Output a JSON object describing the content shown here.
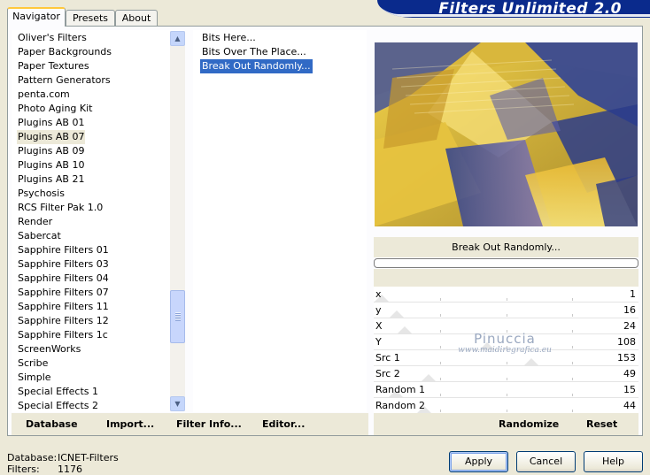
{
  "app": {
    "title": "Filters Unlimited 2.0"
  },
  "tabs": [
    {
      "label": "Navigator",
      "active": true
    },
    {
      "label": "Presets",
      "active": false
    },
    {
      "label": "About",
      "active": false
    }
  ],
  "categories": {
    "items": [
      "Oliver's Filters",
      "Paper Backgrounds",
      "Paper Textures",
      "Pattern Generators",
      "penta.com",
      "Photo Aging Kit",
      "Plugins AB 01",
      "Plugins AB 07",
      "Plugins AB 09",
      "Plugins AB 10",
      "Plugins AB 21",
      "Psychosis",
      "RCS Filter Pak 1.0",
      "Render",
      "Sabercat",
      "Sapphire Filters 01",
      "Sapphire Filters 03",
      "Sapphire Filters 04",
      "Sapphire Filters 07",
      "Sapphire Filters 11",
      "Sapphire Filters 12",
      "Sapphire Filters 1c",
      "ScreenWorks",
      "Scribe",
      "Simple",
      "Special Effects 1",
      "Special Effects 2"
    ],
    "selected": "Plugins AB 07"
  },
  "filters": {
    "items": [
      "Bits Here...",
      "Bits Over The Place...",
      "Break Out Randomly..."
    ],
    "selected": "Break Out Randomly..."
  },
  "preview": {
    "filter_name": "Break Out Randomly..."
  },
  "params": [
    {
      "label": "x",
      "value": "1"
    },
    {
      "label": "y",
      "value": "16"
    },
    {
      "label": "X",
      "value": "24"
    },
    {
      "label": "Y",
      "value": "108"
    },
    {
      "label": "Src 1",
      "value": "153"
    },
    {
      "label": "Src 2",
      "value": "49"
    },
    {
      "label": "Random 1",
      "value": "15"
    },
    {
      "label": "Random 2",
      "value": "44"
    }
  ],
  "param_levels": [
    1,
    16,
    24,
    108,
    153,
    49,
    15,
    44
  ],
  "param_max": 255,
  "watermark": {
    "name": "Pinuccia",
    "url": "www.maidiregrafica.eu"
  },
  "toolbar": {
    "database": "Database",
    "import": "Import...",
    "filter_info": "Filter Info...",
    "editor": "Editor...",
    "randomize": "Randomize",
    "reset": "Reset"
  },
  "footer": {
    "database_label": "Database:",
    "database_value": "ICNET-Filters",
    "filters_label": "Filters:",
    "filters_value": "1176",
    "apply": "Apply",
    "cancel": "Cancel",
    "help": "Help"
  },
  "colors": {
    "accent": "#316ac5",
    "banner": "#0a2a8c",
    "face": "#ece9d8"
  }
}
